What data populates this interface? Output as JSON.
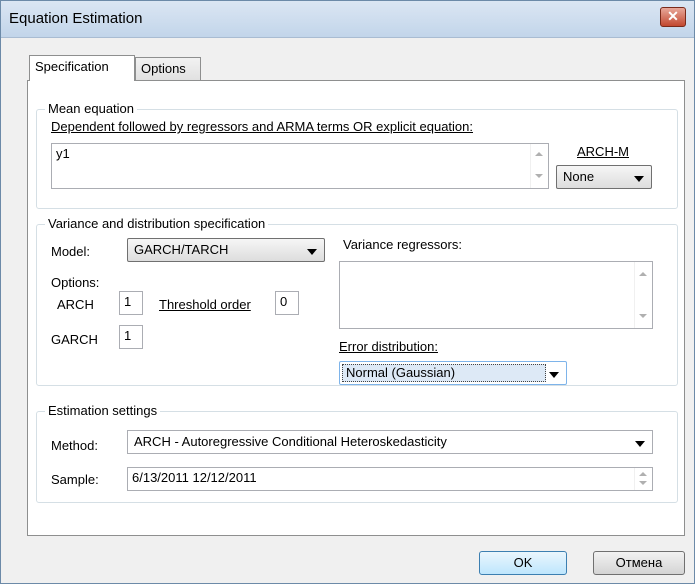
{
  "window": {
    "title": "Equation Estimation",
    "close_glyph": "✕"
  },
  "tabs": [
    {
      "label": "Specification"
    },
    {
      "label": "Options"
    }
  ],
  "mean_equation": {
    "group_title": "Mean equation",
    "prompt": "Dependent followed by regressors and ARMA terms OR explicit equation:",
    "value": "y1",
    "archm_label": "ARCH-M",
    "archm_value": "None"
  },
  "variance": {
    "group_title": "Variance and distribution specification",
    "model_label": "Model:",
    "model_value": "GARCH/TARCH",
    "options_label": "Options:",
    "arch_label": "ARCH",
    "arch_value": "1",
    "threshold_label": "Threshold order",
    "threshold_value": "0",
    "garch_label": "GARCH",
    "garch_value": "1",
    "regressors_label": "Variance regressors:",
    "regressors_value": "",
    "error_dist_label": "Error distribution:",
    "error_dist_value": "Normal (Gaussian)"
  },
  "estimation": {
    "group_title": "Estimation settings",
    "method_label": "Method:",
    "method_value": "ARCH  -  Autoregressive Conditional Heteroskedasticity",
    "sample_label": "Sample:",
    "sample_value": "6/13/2011 12/12/2011"
  },
  "buttons": {
    "ok": "OK",
    "cancel": "Отмена"
  }
}
